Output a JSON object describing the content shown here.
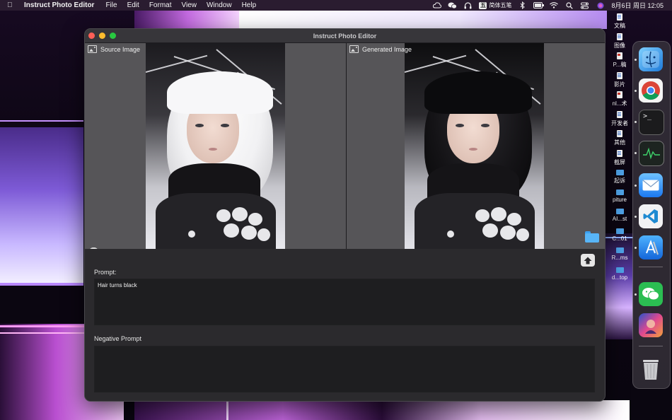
{
  "menubar": {
    "app_name": "Instruct Photo Editor",
    "menus": [
      "File",
      "Edit",
      "Format",
      "View",
      "Window",
      "Help"
    ],
    "ime_char": "五",
    "input_method": "简体五笔",
    "datetime": "8月6日 周日  12:05"
  },
  "desktop": {
    "items": [
      {
        "label": "文稿",
        "icon": "doc-icon"
      },
      {
        "label": "图像",
        "icon": "doc-icon"
      },
      {
        "label": "P...稿",
        "icon": "pdf-icon"
      },
      {
        "label": "影片",
        "icon": "doc-icon"
      },
      {
        "label": "nl...术",
        "icon": "pdf-icon"
      },
      {
        "label": "开发者",
        "icon": "doc-icon"
      },
      {
        "label": "其他",
        "icon": "doc-icon"
      },
      {
        "label": "截屏",
        "icon": "doc-icon"
      },
      {
        "label": "起诉",
        "icon": "folder-icon"
      },
      {
        "label": "piture",
        "icon": "folder-icon"
      },
      {
        "label": "AI...st",
        "icon": "folder-icon"
      },
      {
        "label": "C...01",
        "icon": "folder-icon"
      },
      {
        "label": "R...ms",
        "icon": "folder-icon"
      },
      {
        "label": "d...top",
        "icon": "folder-icon"
      }
    ]
  },
  "window": {
    "title": "Instruct Photo Editor",
    "source_label": "Source Image",
    "generated_label": "Generated Image",
    "add_icon": "plus-circle-icon",
    "upload_icon": "upload-arrow-icon",
    "folder_icon": "folder-icon"
  },
  "prompt": {
    "label": "Prompt:",
    "value": "Hair turns black"
  },
  "negative_prompt": {
    "label": "Negative Prompt",
    "value": ""
  },
  "dock": {
    "apps": [
      "finder-icon",
      "chrome-icon",
      "terminal-icon",
      "activity-monitor-icon",
      "mail-icon",
      "vscode-icon",
      "xcode-icon",
      "wechat-icon",
      "photo-app-icon",
      "trash-icon"
    ]
  },
  "colors": {
    "window_bg": "#2b2a2d",
    "pane_bg": "#565558",
    "field_bg": "#1e1e20",
    "accent_folder": "#58b5f7"
  }
}
